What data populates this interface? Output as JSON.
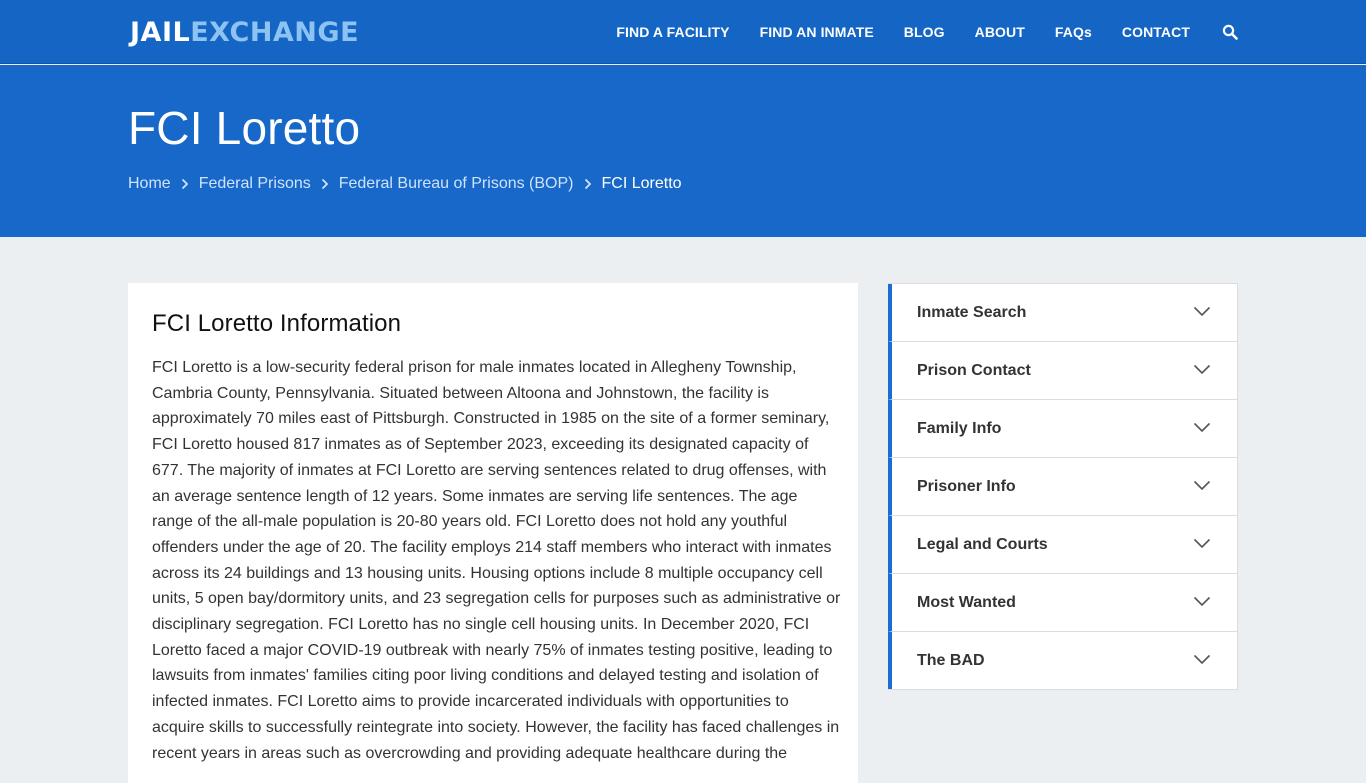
{
  "header": {
    "logo_part1": "JAIL",
    "logo_part2": "EXCHANGE",
    "nav": [
      "FIND A FACILITY",
      "FIND AN INMATE",
      "BLOG",
      "ABOUT",
      "FAQs",
      "CONTACT"
    ]
  },
  "hero": {
    "title": "FCI Loretto",
    "breadcrumbs": [
      "Home",
      "Federal Prisons",
      "Federal Bureau of Prisons (BOP)"
    ],
    "current": "FCI Loretto"
  },
  "main": {
    "heading": "FCI Loretto Information",
    "body": "FCI Loretto is a low-security federal prison for male inmates located in Allegheny Township, Cambria County, Pennsylvania. Situated between Altoona and Johnstown, the facility is approximately 70 miles east of Pittsburgh. Constructed in 1985 on the site of a former seminary, FCI Loretto housed 817 inmates as of September 2023, exceeding its designated capacity of 677. The majority of inmates at FCI Loretto are serving sentences related to drug offenses, with an average sentence length of 12 years. Some inmates are serving life sentences. The age range of the all-male population is 20-80 years old. FCI Loretto does not hold any youthful offenders under the age of 20. The facility employs 214 staff members who interact with inmates across its 24 buildings and 13 housing units. Housing options include 8 multiple occupancy cell units, 5 open bay/dormitory units, and 23 segregation cells for purposes such as administrative or disciplinary segregation. FCI Loretto has no single cell housing units. In December 2020, FCI Loretto faced a major COVID-19 outbreak with nearly 75% of inmates testing positive, leading to lawsuits from inmates' families citing poor living conditions and delayed testing and isolation of infected inmates. FCI Loretto aims to provide incarcerated individuals with opportunities to acquire skills to successfully reintegrate into society. However, the facility has faced challenges in recent years in areas such as overcrowding and providing adequate healthcare during the"
  },
  "sidebar": {
    "items": [
      "Inmate Search",
      "Prison Contact",
      "Family Info",
      "Prisoner Info",
      "Legal and Courts",
      "Most Wanted",
      "The BAD"
    ]
  },
  "colors": {
    "header_bg": "#1565c4",
    "hero_bg": "#1768c9",
    "accent": "#1a6ed2",
    "page_bg": "#eceff2"
  },
  "icons": {
    "nav_search": "search-icon",
    "breadcrumb_separator": "chevron-right-icon",
    "sidebar_toggle": "chevron-down-icon"
  }
}
